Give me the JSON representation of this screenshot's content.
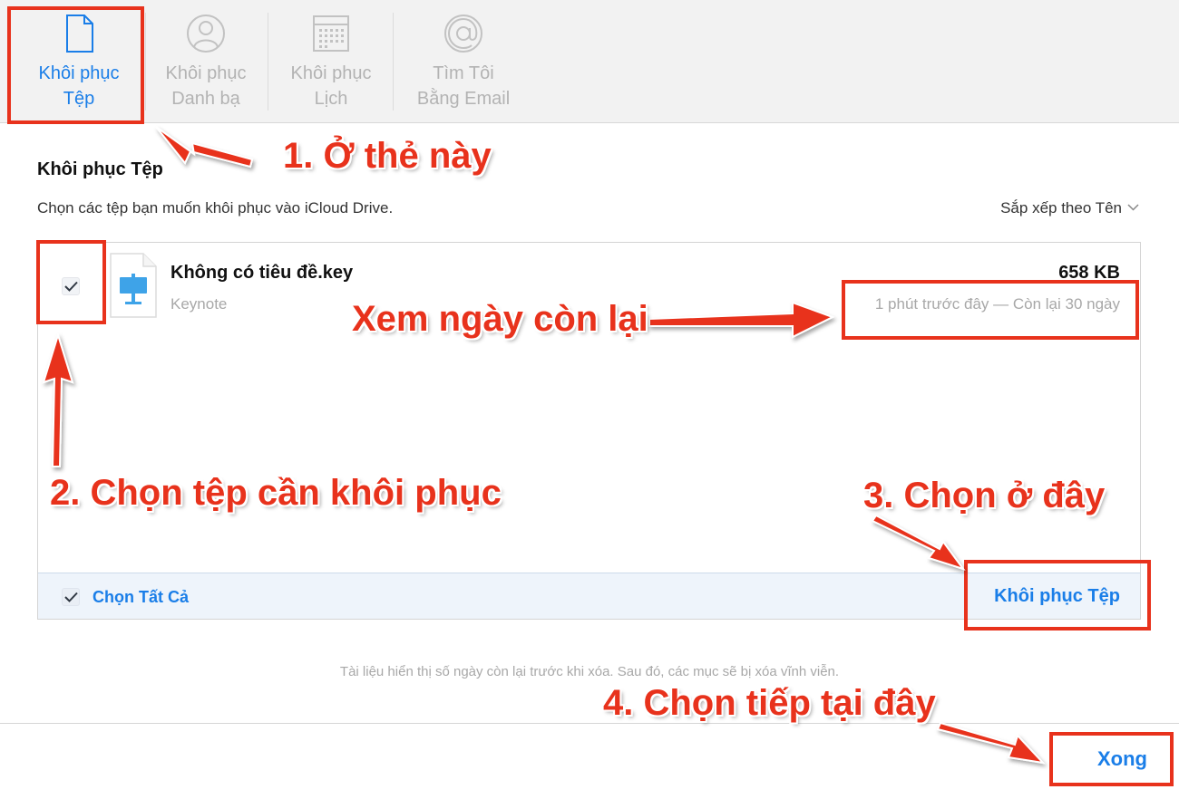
{
  "tabs": [
    {
      "label": "Khôi phục\nTệp",
      "icon": "document-icon",
      "active": true
    },
    {
      "label": "Khôi phục\nDanh bạ",
      "icon": "contact-icon",
      "active": false
    },
    {
      "label": "Khôi phục\nLịch",
      "icon": "calendar-icon",
      "active": false
    },
    {
      "label": "Tìm Tôi\nBằng Email",
      "icon": "at-sign-icon",
      "active": false
    }
  ],
  "section": {
    "title": "Khôi phục Tệp",
    "description": "Chọn các tệp bạn muốn khôi phục vào iCloud Drive.",
    "sort_label": "Sắp xếp theo Tên"
  },
  "file": {
    "checked": true,
    "name": "Không có tiêu đề.key",
    "kind": "Keynote",
    "size": "658 KB",
    "date": "1 phút trước đây — Còn lại 30 ngày"
  },
  "footer": {
    "select_all_label": "Chọn Tất Cả",
    "restore_label": "Khôi phục Tệp"
  },
  "note": "Tài liệu hiển thị số ngày còn lại trước khi xóa. Sau đó, các mục sẽ bị xóa vĩnh viễn.",
  "done_label": "Xong",
  "annotations": {
    "step1": "1. Ở thẻ này",
    "step2": "2. Chọn tệp cần khôi phục",
    "step3": "3. Chọn ở đây",
    "step4": "4. Chọn tiếp tại đây",
    "days_left": "Xem ngày còn lại"
  },
  "colors": {
    "accent": "#1a7ee8",
    "annotation": "#e8321c",
    "muted_text": "#a8a8a8",
    "tabbar_bg": "#f2f2f2",
    "footer_bg": "#eef4fb"
  }
}
